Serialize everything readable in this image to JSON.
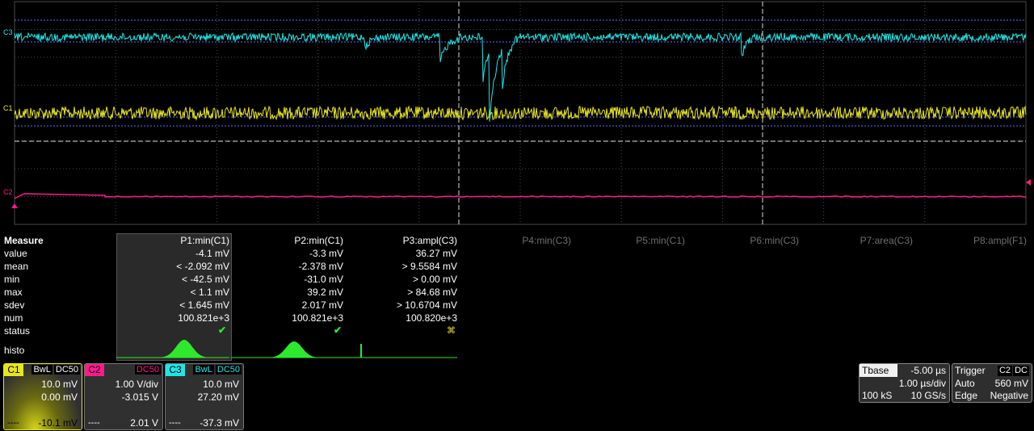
{
  "grid": {
    "bg": "#000000",
    "line": "#4a4a4a",
    "dash": "#7a7a7a"
  },
  "channels": {
    "c1": {
      "marker": "C1",
      "color": "#e6e61e"
    },
    "c2": {
      "marker": "C2",
      "color": "#ff1a8c"
    },
    "c3": {
      "marker": "C3",
      "color": "#1ee6e6"
    }
  },
  "measure": {
    "title": "Measure",
    "rows": [
      "value",
      "mean",
      "min",
      "max",
      "sdev",
      "num",
      "status"
    ],
    "histo_label": "histo",
    "params": [
      {
        "name": "P1:min(C1)",
        "value": "-4.1 mV",
        "mean": "< -2.092 mV",
        "min": "< -42.5 mV",
        "max": "< 1.1 mV",
        "sdev": "< 1.645 mV",
        "num": "100.821e+3",
        "status": "✔"
      },
      {
        "name": "P2:min(C1)",
        "value": "-3.3 mV",
        "mean": "-2.378 mV",
        "min": "-31.0 mV",
        "max": "39.2 mV",
        "sdev": "2.017 mV",
        "num": "100.821e+3",
        "status": "✔"
      },
      {
        "name": "P3:ampl(C3)",
        "value": "36.27 mV",
        "mean": "> 9.5584 mV",
        "min": "> 0.00 mV",
        "max": "> 84.68 mV",
        "sdev": "> 10.6704 mV",
        "num": "100.820e+3",
        "status": "⌘"
      }
    ],
    "inactive": [
      "P4:min(C3)",
      "P5:min(C1)",
      "P6:min(C3)",
      "P7:area(C3)",
      "P8:ampl(F1)"
    ]
  },
  "descriptors": [
    {
      "tag": "C1",
      "flags": [
        "BwL",
        "DC50"
      ],
      "vdiv": "10.0 mV",
      "offset": "0.00 mV",
      "bottom": "-10.1 mV",
      "color": "#e6e61e"
    },
    {
      "tag": "C2",
      "flags": [
        "DC50"
      ],
      "vdiv": "1.00 V/div",
      "offset": "-3.015 V",
      "bottom": "2.01 V",
      "color": "#ff1a8c"
    },
    {
      "tag": "C3",
      "flags": [
        "BwL",
        "DC50"
      ],
      "vdiv": "10.0 mV",
      "offset": "27.20 mV",
      "bottom": "-37.3 mV",
      "color": "#1ee6e6"
    }
  ],
  "timebase": {
    "label": "Tbase",
    "delay": "-5.00 µs",
    "div": "1.00 µs/div",
    "samples": "100 kS",
    "rate": "10 GS/s"
  },
  "trigger": {
    "label": "Trigger",
    "src": "C2",
    "coupling": "DC",
    "mode": "Auto",
    "level": "560 mV",
    "type": "Edge",
    "slope": "Negative"
  }
}
